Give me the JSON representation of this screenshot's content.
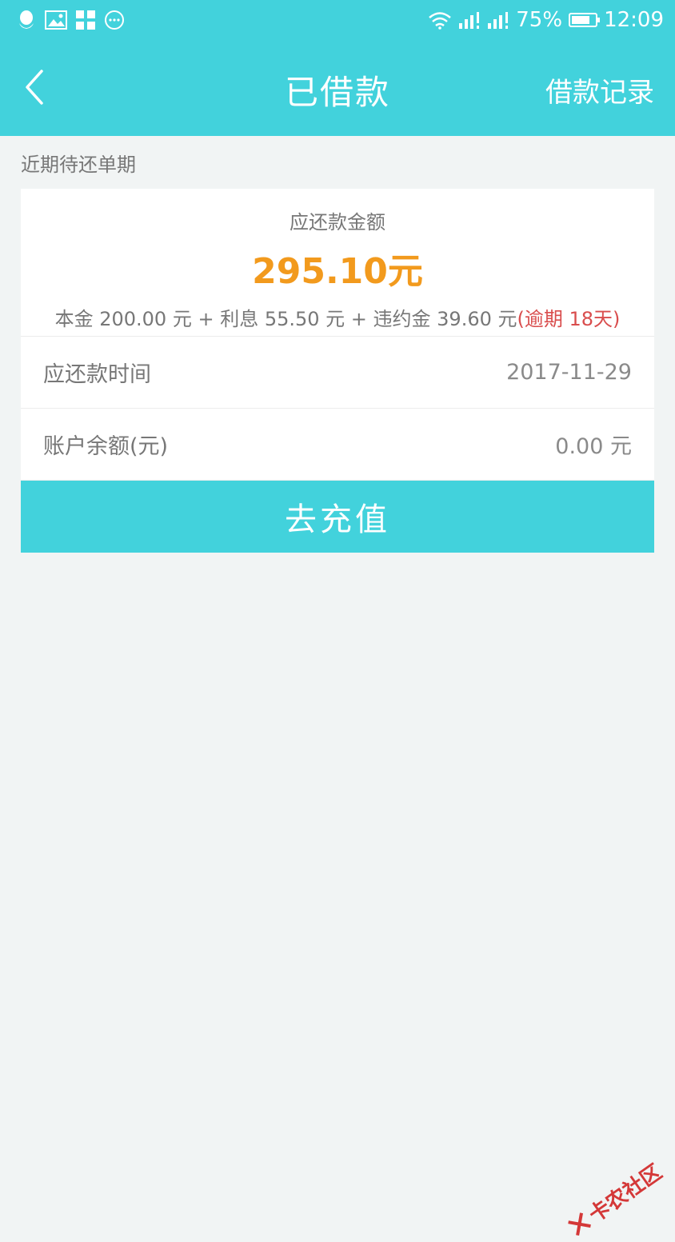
{
  "status_bar": {
    "battery_percent": "75%",
    "time": "12:09"
  },
  "header": {
    "title": "已借款",
    "history_link": "借款记录"
  },
  "section": {
    "label": "近期待还单期"
  },
  "summary": {
    "title": "应还款金额",
    "amount": "295.10元",
    "detail": "本金 200.00 元 + 利息 55.50 元 + 违约金 39.60 元",
    "overdue": "(逾期 18天)"
  },
  "rows": [
    {
      "label": "应还款时间",
      "value": "2017-11-29"
    },
    {
      "label": "账户余额(元)",
      "value": "0.00  元"
    }
  ],
  "actions": {
    "recharge": "去充值"
  },
  "watermark": {
    "text": "卡农社区"
  },
  "colors": {
    "primary": "#42d2dc",
    "amount": "#f29a1d",
    "overdue": "#d94d4d",
    "background": "#f1f4f4"
  }
}
